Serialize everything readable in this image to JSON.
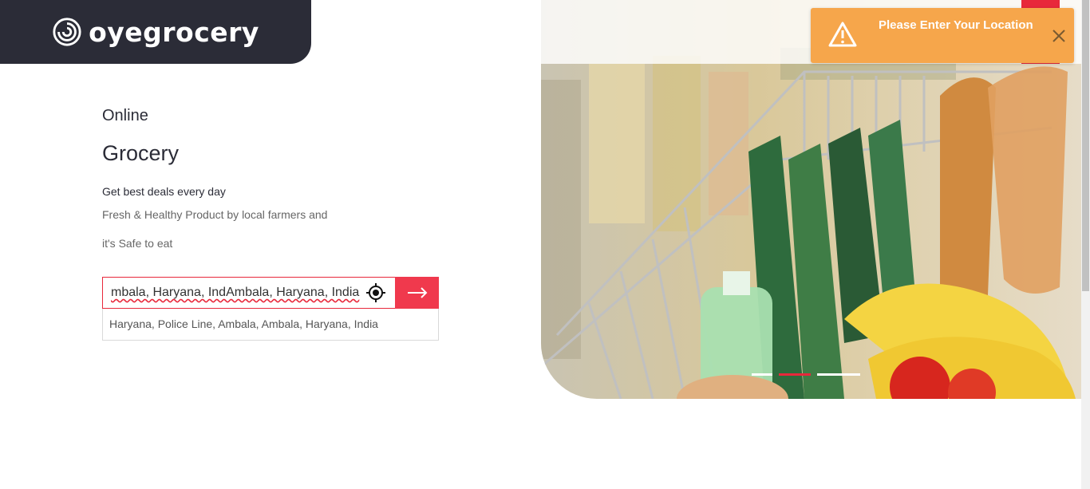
{
  "brand": {
    "name": "oyegrocery"
  },
  "hero": {
    "eyebrow": "Online",
    "headline": "Grocery",
    "tagline_1": "Get best deals every day",
    "tagline_2": "Fresh & Healthy Product by local farmers and",
    "tagline_3": "it's Safe to eat"
  },
  "search": {
    "value": "mbala, Haryana, IndAmbala, Haryana, India",
    "locate_icon": "crosshair-icon",
    "submit_icon": "arrow-right-icon"
  },
  "suggestions": [
    "Haryana, Police Line, Ambala, Ambala, Haryana, India"
  ],
  "slider": {
    "active_index": 1,
    "count": 3
  },
  "toast": {
    "message": "Please Enter Your Location",
    "type": "warning",
    "icon": "warning-icon",
    "close_icon": "close-icon"
  },
  "colors": {
    "brand_dark": "#2b2c37",
    "accent_red": "#f0394d",
    "toast_orange": "#f6a64b"
  }
}
